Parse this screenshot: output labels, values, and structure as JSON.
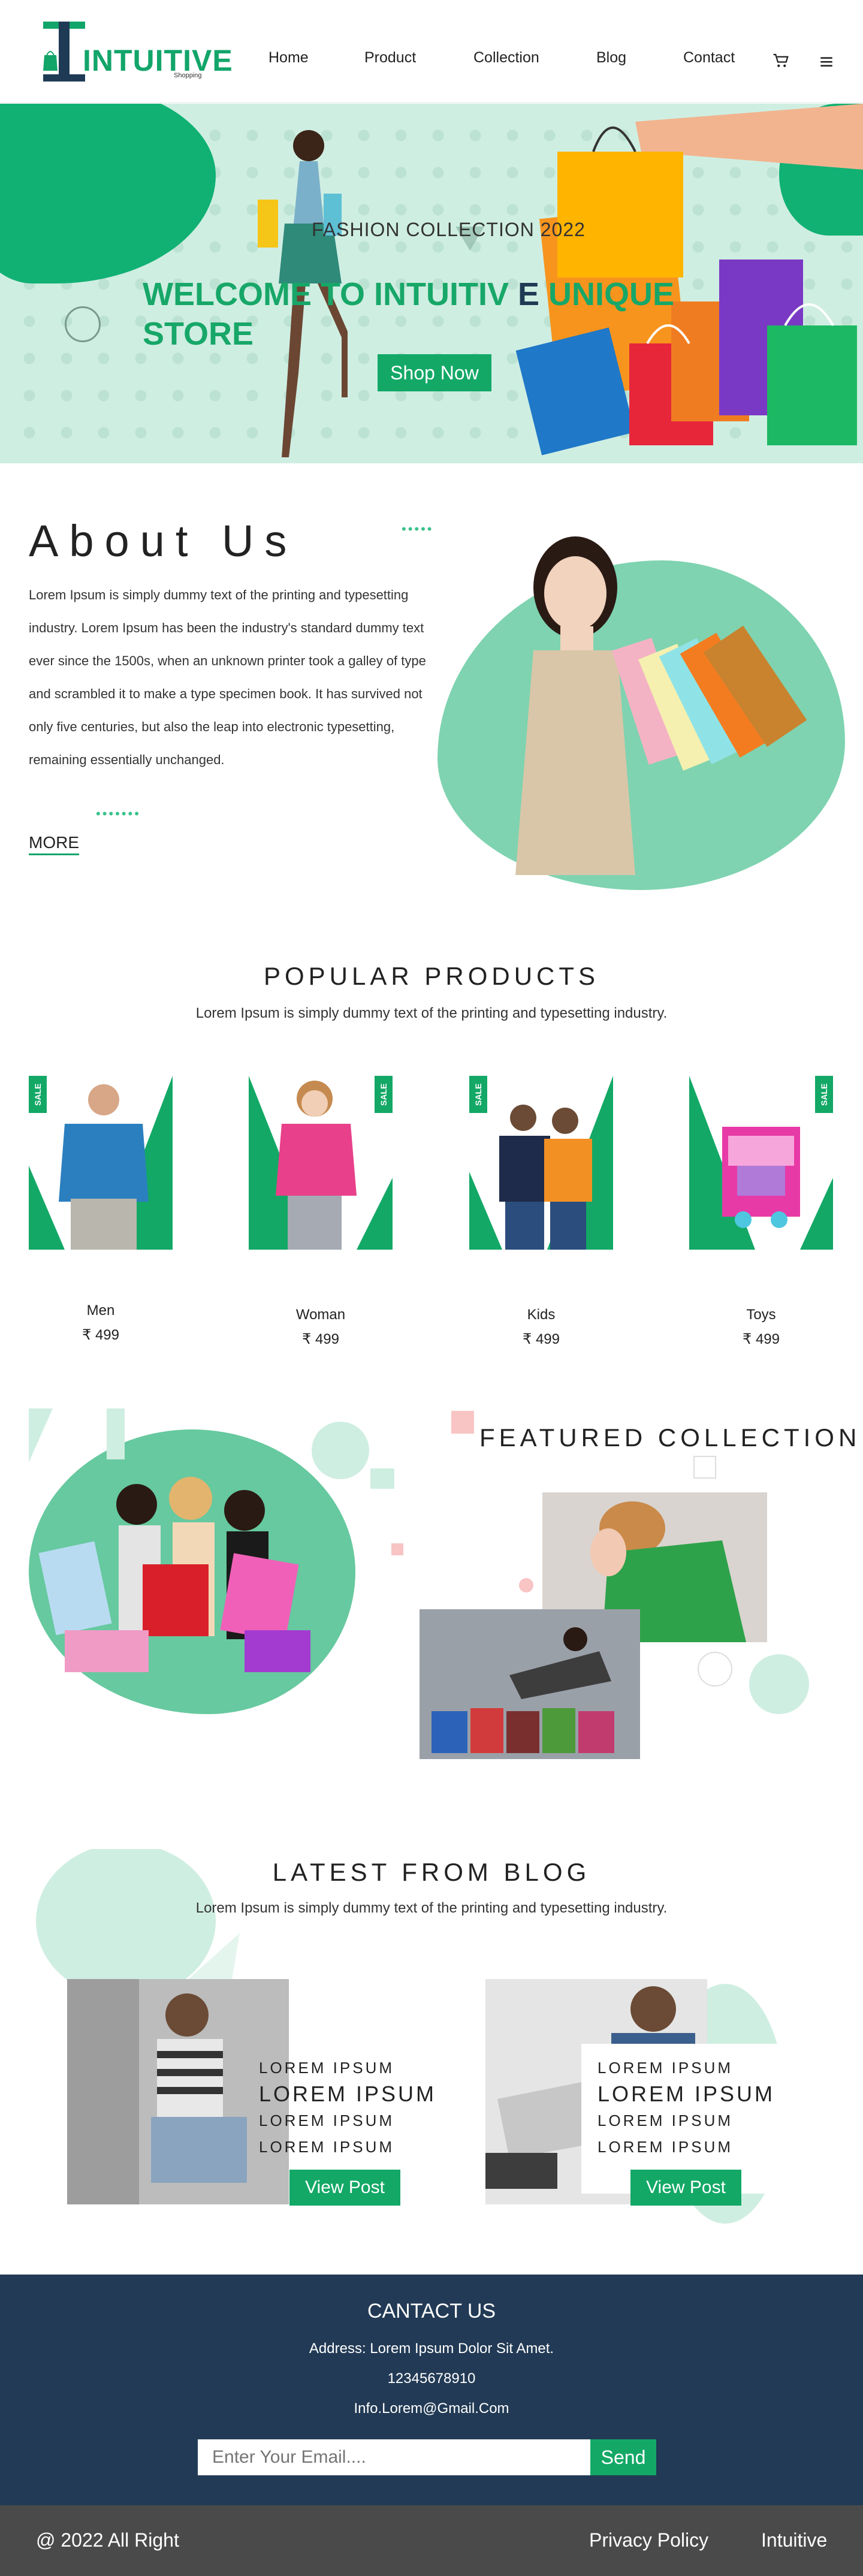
{
  "brand": {
    "name": "INTUITIVE",
    "tagline": "Shopping"
  },
  "nav": {
    "items": [
      "Home",
      "Product",
      "Collection",
      "Blog",
      "Contact"
    ],
    "cart_icon": "cart-icon",
    "menu_icon": "hamburger-icon"
  },
  "hero": {
    "subtitle": "FASHION COLLECTION 2022",
    "title_part1": "WELCOME TO INTUITIV",
    "title_part2": "E",
    "title_part3": "UNIQUE",
    "title_line2": "STORE",
    "button": "Shop Now"
  },
  "about": {
    "title": "About Us",
    "text": "Lorem Ipsum is simply dummy text of the printing and typesetting industry. Lorem Ipsum has been the industry's standard dummy text ever since the 1500s, when an unknown printer took a galley of type and scrambled it to make a type specimen book. It has survived not only five centuries, but also the leap into electronic typesetting, remaining essentially unchanged.",
    "more": "MORE"
  },
  "popular": {
    "title": "POPULAR PRODUCTS",
    "subtitle": "Lorem Ipsum is simply dummy text of the printing and typesetting industry.",
    "sale_label": "SALE",
    "products": [
      {
        "name": "Men",
        "price": "₹ 499"
      },
      {
        "name": "Woman",
        "price": "₹ 499"
      },
      {
        "name": "Kids",
        "price": "₹ 499"
      },
      {
        "name": "Toys",
        "price": "₹ 499"
      }
    ]
  },
  "featured": {
    "title": "FEATURED COLLECTION"
  },
  "blog": {
    "title": "LATEST FROM BLOG",
    "subtitle": "Lorem Ipsum is simply dummy text of the printing and typesetting industry.",
    "posts": [
      {
        "l1": "LOREM IPSUM",
        "l2": "LOREM IPSUM",
        "l3": "LOREM IPSUM",
        "l4": "LOREM IPSUM",
        "button": "View Post"
      },
      {
        "l1": "LOREM IPSUM",
        "l2": "LOREM IPSUM",
        "l3": "LOREM IPSUM",
        "l4": "LOREM IPSUM",
        "button": "View Post"
      }
    ]
  },
  "contact": {
    "title": "CANTACT US",
    "address": "Address: Lorem Ipsum Dolor Sit Amet.",
    "phone": "12345678910",
    "email": "Info.Lorem@Gmail.Com",
    "input_placeholder": "Enter Your Email....",
    "send": "Send"
  },
  "footer": {
    "copyright": "@ 2022 All Right",
    "privacy": "Privacy Policy",
    "brand": "Intuitive"
  },
  "colors": {
    "accent": "#13a866",
    "dark": "#223a55",
    "hero_bg": "#cfeee2",
    "footer": "#4a4a4a"
  }
}
